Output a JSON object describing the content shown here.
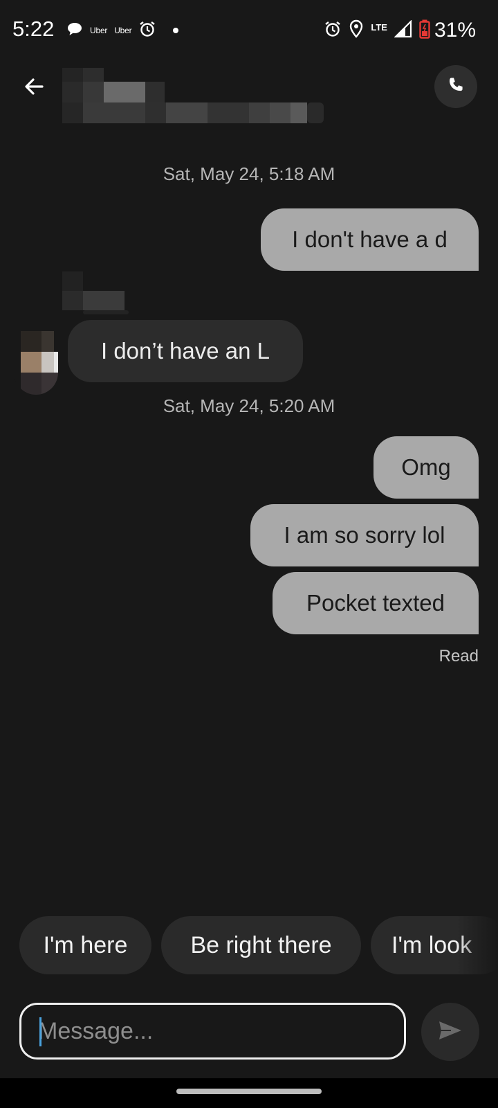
{
  "status_bar": {
    "time": "5:22",
    "notifications": [
      "chat-bubble-icon",
      "Uber",
      "Uber",
      "alarm-icon",
      "dot"
    ],
    "uber_label_1": "Uber",
    "uber_label_2": "Uber",
    "network": "LTE",
    "battery": "31%"
  },
  "header": {
    "back_icon": "arrow-left-icon",
    "call_icon": "phone-icon"
  },
  "messages": [
    {
      "type": "timestamp",
      "text": "Sat, May 24, 5:18 AM"
    },
    {
      "type": "outgoing",
      "text": "I don't have a d"
    },
    {
      "type": "incoming",
      "text": "I don’t have an L"
    },
    {
      "type": "timestamp",
      "text": "Sat, May 24, 5:20 AM"
    },
    {
      "type": "outgoing",
      "text": "Omg"
    },
    {
      "type": "outgoing",
      "text": "I am so sorry lol"
    },
    {
      "type": "outgoing",
      "text": "Pocket texted"
    }
  ],
  "read_receipt": "Read",
  "quick_replies": [
    "I'm here",
    "Be right there",
    "I'm look"
  ],
  "composer": {
    "placeholder": "Message..."
  },
  "colors": {
    "background": "#181818",
    "outgoing_bubble": "#a9a9a9",
    "incoming_bubble": "#2c2c2c",
    "caret": "#4aa3df",
    "battery_low": "#e53935"
  }
}
